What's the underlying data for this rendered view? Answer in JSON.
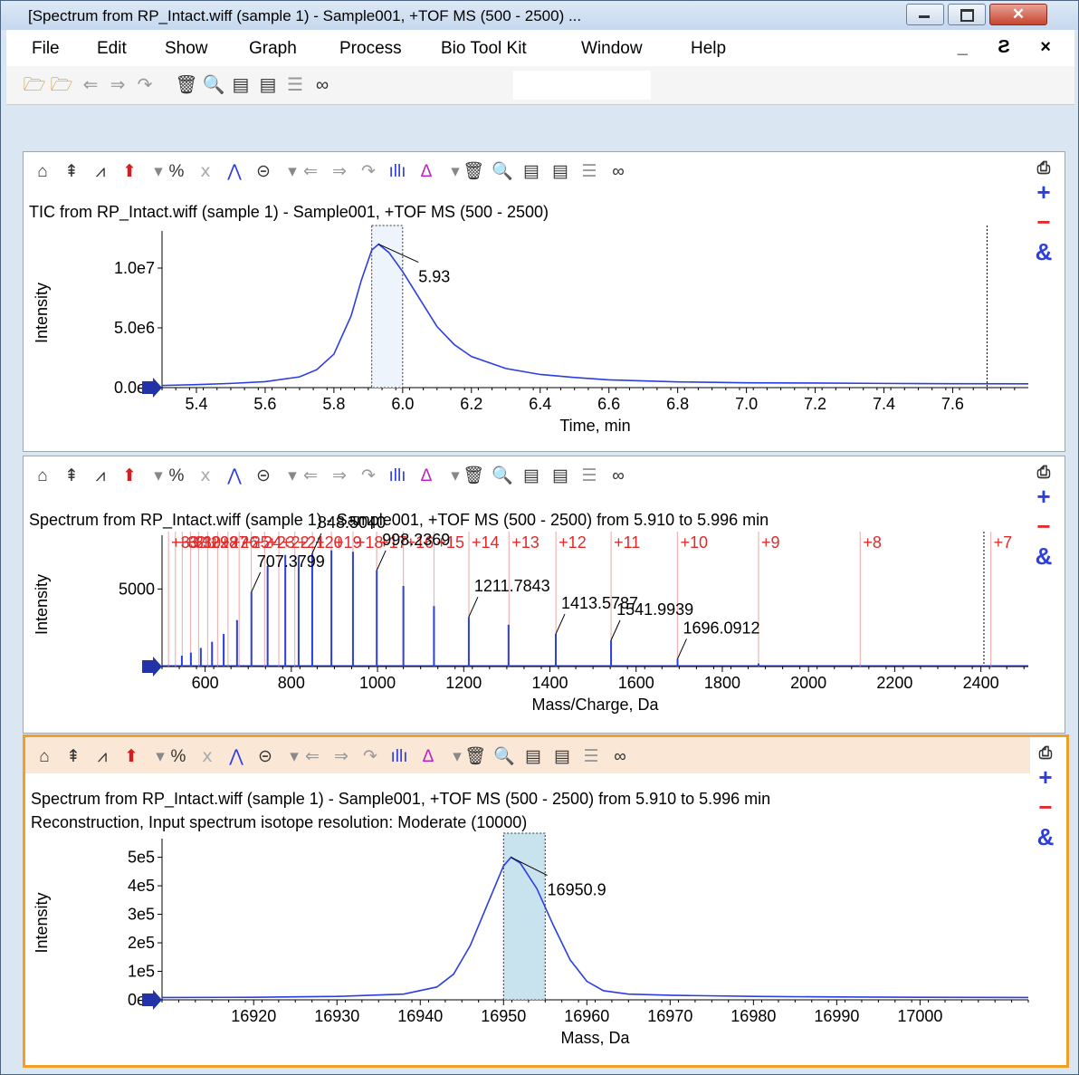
{
  "window": {
    "title": "[Spectrum from RP_Intact.wiff (sample 1) - Sample001, +TOF MS (500 - 2500) ...",
    "buttons": [
      "minimize",
      "maximize",
      "close"
    ]
  },
  "menu": {
    "items": [
      "File",
      "Edit",
      "Show",
      "Graph",
      "Process",
      "Bio Tool Kit",
      "Window",
      "Help"
    ],
    "mdi_controls": "_ Ƨ ×"
  },
  "toolbar": {
    "icons": [
      "open-folder-icon",
      "open-folder-alt-icon",
      "back-icon",
      "forward-icon",
      "forward-alt-icon",
      "delete-icon",
      "zoom-icon",
      "window-icon",
      "window-alt-icon",
      "lines-icon",
      "binoculars-icon"
    ]
  },
  "pane_toolbar_icons": [
    "home-icon",
    "extract-icon",
    "peak-icon",
    "arrow-up-icon",
    "dropdown-icon",
    "percent-icon",
    "xxx-icon",
    "spectrum-icon",
    "link-icon",
    "dropdown-icon",
    "back-icon",
    "forward-icon",
    "forward-alt-icon",
    "bar-chart-icon",
    "peak-label-icon",
    "dropdown-icon",
    "delete-icon",
    "zoom-icon",
    "window-icon",
    "window-alt-icon",
    "lines-icon",
    "binoculars-icon"
  ],
  "side_buttons": {
    "add": "+",
    "remove": "−",
    "overlay": "&"
  },
  "panes": [
    {
      "title": "TIC from RP_Intact.wiff (sample 1) - Sample001, +TOF MS (500 - 2500)",
      "chart_data": {
        "type": "line",
        "xlabel": "Time, min",
        "ylabel": "Intensity",
        "xlim": [
          5.3,
          7.82
        ],
        "ylim": [
          0,
          12500000
        ],
        "xticks": [
          5.4,
          5.6,
          5.8,
          6.0,
          6.2,
          6.4,
          6.6,
          6.8,
          7.0,
          7.2,
          7.4,
          7.6
        ],
        "xtick_labels": [
          "5.4",
          "5.6",
          "5.8",
          "6.0",
          "6.2",
          "6.4",
          "6.6",
          "6.8",
          "7.0",
          "7.2",
          "7.4",
          "7.6"
        ],
        "yticks": [
          0,
          5000000,
          10000000
        ],
        "ytick_labels": [
          "0.0e0",
          "5.0e6",
          "1.0e7"
        ],
        "series": [
          {
            "x": [
              5.3,
              5.4,
              5.5,
              5.6,
              5.7,
              5.75,
              5.8,
              5.85,
              5.88,
              5.91,
              5.93,
              5.96,
              6.0,
              6.05,
              6.1,
              6.15,
              6.2,
              6.3,
              6.4,
              6.5,
              6.6,
              6.8,
              7.0,
              7.2,
              7.4,
              7.6,
              7.82
            ],
            "y": [
              180000,
              250000,
              350000,
              500000,
              900000,
              1500000,
              2800000,
              6000000,
              9000000,
              11500000,
              12000000,
              11300000,
              9700000,
              7400000,
              5100000,
              3600000,
              2600000,
              1600000,
              1100000,
              850000,
              650000,
              480000,
              400000,
              380000,
              350000,
              330000,
              320000
            ]
          }
        ],
        "peak_label": {
          "x": 5.93,
          "y": 12000000,
          "text": "5.93"
        },
        "selection": [
          5.91,
          6.0
        ],
        "marker_line_x": 7.7
      }
    },
    {
      "title": "Spectrum from RP_Intact.wiff (sample 1) - Sample001, +TOF MS (500 - 2500) from 5.910 to 5.996 min",
      "chart_data": {
        "type": "bar",
        "xlabel": "Mass/Charge, Da",
        "ylabel": "Intensity",
        "xlim": [
          500,
          2510
        ],
        "ylim": [
          0,
          8000
        ],
        "xticks": [
          600,
          800,
          1000,
          1200,
          1400,
          1600,
          1800,
          2000,
          2200,
          2400
        ],
        "xtick_labels": [
          "600",
          "800",
          "1000",
          "1200",
          "1400",
          "1600",
          "1800",
          "2000",
          "2200",
          "2400"
        ],
        "yticks": [
          0,
          5000
        ],
        "ytick_labels": [
          "0",
          "5000"
        ],
        "peaks": [
          {
            "mz": 546,
            "i": 700
          },
          {
            "mz": 567,
            "i": 900
          },
          {
            "mz": 590,
            "i": 1200
          },
          {
            "mz": 616,
            "i": 1600
          },
          {
            "mz": 643,
            "i": 2100
          },
          {
            "mz": 674,
            "i": 3000
          },
          {
            "mz": 707.4,
            "i": 4800
          },
          {
            "mz": 745,
            "i": 6500
          },
          {
            "mz": 786,
            "i": 7200
          },
          {
            "mz": 817,
            "i": 7100
          },
          {
            "mz": 848.5,
            "i": 7300
          },
          {
            "mz": 893,
            "i": 7500
          },
          {
            "mz": 943,
            "i": 7400
          },
          {
            "mz": 998.2,
            "i": 6200
          },
          {
            "mz": 1060,
            "i": 5200
          },
          {
            "mz": 1131,
            "i": 3900
          },
          {
            "mz": 1211.8,
            "i": 3200
          },
          {
            "mz": 1304,
            "i": 2700
          },
          {
            "mz": 1413.6,
            "i": 2100
          },
          {
            "mz": 1541.9,
            "i": 1700
          },
          {
            "mz": 1696.1,
            "i": 500
          },
          {
            "mz": 1884,
            "i": 200
          }
        ],
        "peak_labels": [
          {
            "mz": 707.4,
            "i": 4800,
            "text": "707.3799"
          },
          {
            "mz": 848.5,
            "i": 7300,
            "text": "848.5040"
          },
          {
            "mz": 998.2,
            "i": 6200,
            "text": "998.2369"
          },
          {
            "mz": 1211.8,
            "i": 3200,
            "text": "1211.7843"
          },
          {
            "mz": 1413.6,
            "i": 2100,
            "text": "1413.5787"
          },
          {
            "mz": 1541.9,
            "i": 1700,
            "text": "1541.9939"
          },
          {
            "mz": 1696.1,
            "i": 500,
            "text": "1696.0912"
          }
        ],
        "charge_states": [
          {
            "mz": 2423,
            "label": "+7"
          },
          {
            "mz": 2120,
            "label": "+8"
          },
          {
            "mz": 1884,
            "label": "+9"
          },
          {
            "mz": 1696,
            "label": "+10"
          },
          {
            "mz": 1542,
            "label": "+11"
          },
          {
            "mz": 1414,
            "label": "+12"
          },
          {
            "mz": 1305,
            "label": "+13"
          },
          {
            "mz": 1212,
            "label": "+14"
          },
          {
            "mz": 1131,
            "label": "+15"
          },
          {
            "mz": 1060,
            "label": "+16"
          },
          {
            "mz": 998,
            "label": "+17"
          },
          {
            "mz": 943,
            "label": "+18"
          },
          {
            "mz": 893,
            "label": "+19"
          },
          {
            "mz": 849,
            "label": "+20"
          },
          {
            "mz": 808,
            "label": "+21"
          },
          {
            "mz": 771,
            "label": "+22"
          },
          {
            "mz": 738,
            "label": "+23"
          },
          {
            "mz": 707,
            "label": "+24"
          },
          {
            "mz": 679,
            "label": "+25"
          },
          {
            "mz": 653,
            "label": "+26"
          },
          {
            "mz": 629,
            "label": "+27"
          },
          {
            "mz": 606,
            "label": "+28"
          },
          {
            "mz": 585,
            "label": "+29"
          },
          {
            "mz": 566,
            "label": "+30"
          },
          {
            "mz": 547,
            "label": "+31"
          },
          {
            "mz": 531,
            "label": "+32"
          },
          {
            "mz": 515,
            "label": "+33"
          }
        ],
        "marker_line_x": 2407
      }
    },
    {
      "title": "Spectrum from RP_Intact.wiff (sample 1) - Sample001, +TOF MS (500 - 2500) from 5.910 to 5.996 min",
      "subtitle": "Reconstruction, Input spectrum isotope resolution: Moderate (10000)",
      "chart_data": {
        "type": "line",
        "xlabel": "Mass, Da",
        "ylabel": "Intensity",
        "xlim": [
          16909,
          17013
        ],
        "ylim": [
          0,
          540000
        ],
        "xticks": [
          16920,
          16930,
          16940,
          16950,
          16960,
          16970,
          16980,
          16990,
          17000
        ],
        "xtick_labels": [
          "16920",
          "16930",
          "16940",
          "16950",
          "16960",
          "16970",
          "16980",
          "16990",
          "17000"
        ],
        "yticks": [
          0,
          100000,
          200000,
          300000,
          400000,
          500000
        ],
        "ytick_labels": [
          "0e0",
          "1e5",
          "2e5",
          "3e5",
          "4e5",
          "5e5"
        ],
        "series": [
          {
            "x": [
              16909,
              16920,
              16930,
              16938,
              16942,
              16944,
              16946,
              16948,
              16950,
              16950.9,
              16952,
              16954,
              16956,
              16958,
              16960,
              16962,
              16965,
              16970,
              16980,
              16990,
              17000,
              17013
            ],
            "y": [
              8000,
              9000,
              12000,
              20000,
              45000,
              90000,
              190000,
              330000,
              470000,
              500000,
              480000,
              390000,
              260000,
              140000,
              65000,
              32000,
              20000,
              16000,
              12000,
              10000,
              9000,
              8000
            ]
          }
        ],
        "peak_label": {
          "x": 16950.9,
          "y": 500000,
          "text": "16950.9"
        },
        "selection": [
          16950,
          16955
        ]
      }
    }
  ]
}
